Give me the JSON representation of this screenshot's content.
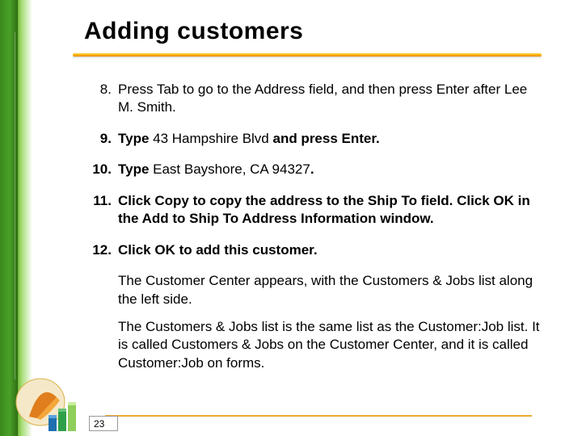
{
  "title": "Adding customers",
  "page_number": "23",
  "steps": [
    {
      "num_bold": false,
      "segments": [
        {
          "t": "Press Tab to go to the Address field, and then press Enter after Lee M. Smith.",
          "b": false
        }
      ]
    },
    {
      "num_bold": true,
      "segments": [
        {
          "t": "Type ",
          "b": true
        },
        {
          "t": "43 Hampshire Blvd",
          "b": false
        },
        {
          "t": " and press Enter.",
          "b": true
        }
      ]
    },
    {
      "num_bold": true,
      "segments": [
        {
          "t": "Type ",
          "b": true
        },
        {
          "t": "East Bayshore, CA 94327",
          "b": false
        },
        {
          "t": ".",
          "b": true
        }
      ]
    },
    {
      "num_bold": true,
      "segments": [
        {
          "t": "Click Copy to copy the address to the Ship To field. Click OK in the Add to Ship To Address Information window.",
          "b": true
        }
      ]
    },
    {
      "num_bold": true,
      "segments": [
        {
          "t": "Click OK to add this customer.",
          "b": true
        }
      ]
    }
  ],
  "followups": [
    "The Customer Center appears, with the Customers & Jobs list along the left side.",
    "The Customers & Jobs list is the same list as the Customer:Job list. It is called Customers & Jobs on the Customer Center, and it is called Customer:Job on forms."
  ]
}
